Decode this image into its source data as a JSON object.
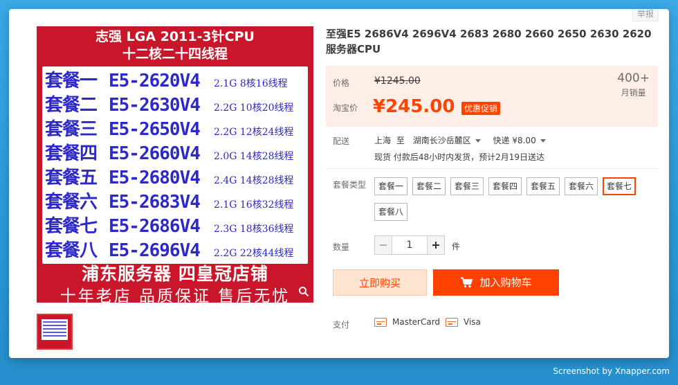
{
  "report_label": "举报",
  "product_image": {
    "title_line1": "志强 LGA 2011-3针CPU",
    "title_line2": "十二核二十四线程",
    "rows": [
      {
        "pkg": "套餐一",
        "model": "E5-2620V4",
        "spec": "2.1G  8核16线程"
      },
      {
        "pkg": "套餐二",
        "model": "E5-2630V4",
        "spec": "2.2G  10核20线程"
      },
      {
        "pkg": "套餐三",
        "model": "E5-2650V4",
        "spec": "2.2G  12核24线程"
      },
      {
        "pkg": "套餐四",
        "model": "E5-2660V4",
        "spec": "2.0G  14核28线程"
      },
      {
        "pkg": "套餐五",
        "model": "E5-2680V4",
        "spec": "2.4G  14核28线程"
      },
      {
        "pkg": "套餐六",
        "model": "E5-2683V4",
        "spec": "2.1G  16核32线程"
      },
      {
        "pkg": "套餐七",
        "model": "E5-2686V4",
        "spec": "2.3G  18核36线程"
      },
      {
        "pkg": "套餐八",
        "model": "E5-2696V4",
        "spec": "2.2G  22核44线程"
      }
    ],
    "bottom_line1": "浦东服务器  四皇冠店铺",
    "bottom_line2": "十年老店 品质保证 售后无忧"
  },
  "product_title": "至强E5 2686V4 2696V4 2683 2680 2660 2650 2630 2620服务器CPU",
  "price_section": {
    "price_label": "价格",
    "original_price": "¥1245.00",
    "taobao_label": "淘宝价",
    "current_price": "¥245.00",
    "promo_badge": "优惠促销",
    "monthly_sales_value": "400+",
    "monthly_sales_label": "月销量"
  },
  "shipping": {
    "label": "配送",
    "from": "上海",
    "to_word": "至",
    "destination": "湖南长沙岳麓区",
    "express": "快递 ¥8.00",
    "note": "现货 付款后48小时内发货，预计2月19日送达"
  },
  "package": {
    "label": "套餐类型",
    "options": [
      "套餐一",
      "套餐二",
      "套餐三",
      "套餐四",
      "套餐五",
      "套餐六",
      "套餐七",
      "套餐八"
    ],
    "selected": "套餐七"
  },
  "quantity": {
    "label": "数量",
    "value": "1",
    "unit": "件"
  },
  "buttons": {
    "buy_now": "立即购买",
    "add_to_cart": "加入购物车"
  },
  "payment": {
    "label": "支付",
    "methods": [
      "MasterCard",
      "Visa"
    ]
  },
  "watermark": "Screenshot by Xnapper.com",
  "colors": {
    "accent": "#ff4400",
    "price_bg": "#fdeee7",
    "page_bg": "#2a9ad8"
  }
}
